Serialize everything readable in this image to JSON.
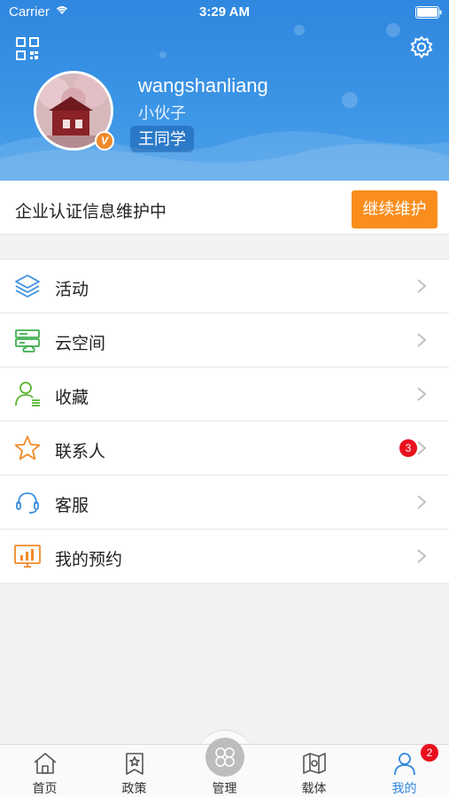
{
  "status_bar": {
    "carrier": "Carrier",
    "time": "3:29 AM"
  },
  "profile": {
    "username": "wangshanliang",
    "subtitle": "小伙子",
    "name_tag": "王同学",
    "verified_badge": "V"
  },
  "certification": {
    "text": "企业认证信息维护中",
    "button_label": "继续维护"
  },
  "menu": [
    {
      "label": "活动",
      "icon": "layers-icon"
    },
    {
      "label": "云空间",
      "icon": "cloud-server-icon"
    },
    {
      "label": "收藏",
      "icon": "user-list-icon"
    },
    {
      "label": "联系人",
      "icon": "star-icon",
      "badge": "3"
    },
    {
      "label": "客服",
      "icon": "headset-icon"
    },
    {
      "label": "我的预约",
      "icon": "chart-board-icon"
    }
  ],
  "tabbar": {
    "tabs": [
      {
        "label": "首页",
        "icon": "home-icon"
      },
      {
        "label": "政策",
        "icon": "policy-icon"
      },
      {
        "label": "管理",
        "icon": "manage-icon"
      },
      {
        "label": "载体",
        "icon": "map-icon"
      },
      {
        "label": "我的",
        "icon": "user-icon",
        "active": true
      }
    ],
    "mine_badge": "2"
  },
  "colors": {
    "header_blue": "#2f87df",
    "accent_orange": "#f98e1d",
    "badge_red": "#e8101e"
  }
}
